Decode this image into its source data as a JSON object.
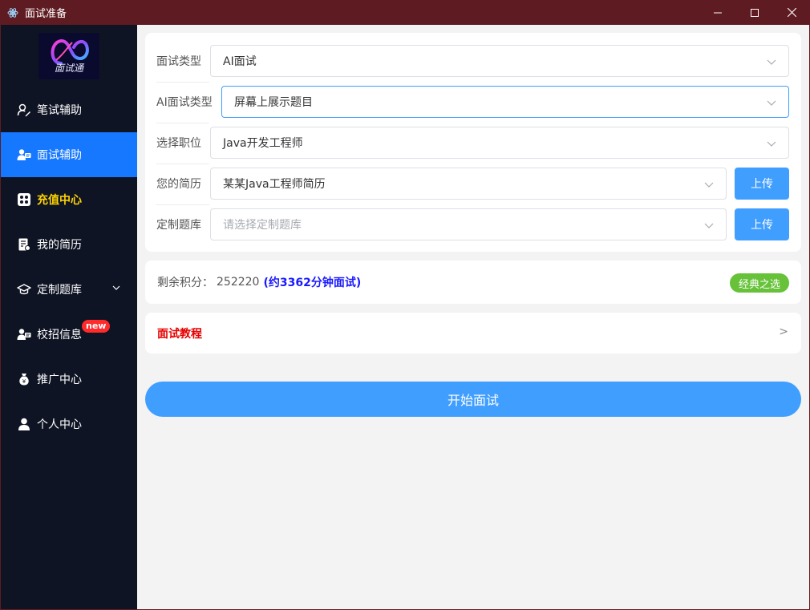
{
  "window": {
    "title": "面试准备"
  },
  "sidebar": {
    "logo_text": "面试通",
    "items": [
      {
        "label": "笔试辅助",
        "icon": "pen-user-icon"
      },
      {
        "label": "面试辅助",
        "icon": "interview-user-icon"
      },
      {
        "label": "充值中心",
        "icon": "grid-icon"
      },
      {
        "label": "我的简历",
        "icon": "resume-icon"
      },
      {
        "label": "定制题库",
        "icon": "graduation-cap-icon"
      },
      {
        "label": "校招信息",
        "icon": "campus-user-icon",
        "badge": "new"
      },
      {
        "label": "推广中心",
        "icon": "money-bag-icon"
      },
      {
        "label": "个人中心",
        "icon": "person-icon"
      }
    ]
  },
  "form": {
    "interview_type": {
      "label": "面试类型",
      "value": "AI面试"
    },
    "ai_type": {
      "label": "AI面试类型",
      "value": "屏幕上展示题目"
    },
    "position": {
      "label": "选择职位",
      "value": "Java开发工程师"
    },
    "resume": {
      "label": "您的简历",
      "value": "某某Java工程师简历",
      "upload_label": "上传"
    },
    "question_bank": {
      "label": "定制题库",
      "placeholder": "请选择定制题库",
      "upload_label": "上传"
    }
  },
  "points": {
    "label": "剩余积分：",
    "value": "252220",
    "minutes": "(约3362分钟面试)",
    "badge": "经典之选"
  },
  "tutorial": {
    "title": "面试教程",
    "arrow": ">"
  },
  "start_label": "开始面试",
  "colors": {
    "accent": "#409eff",
    "active_nav": "#1677ff",
    "highlight": "#ffd400",
    "success": "#67c23a",
    "danger": "#e60000"
  }
}
